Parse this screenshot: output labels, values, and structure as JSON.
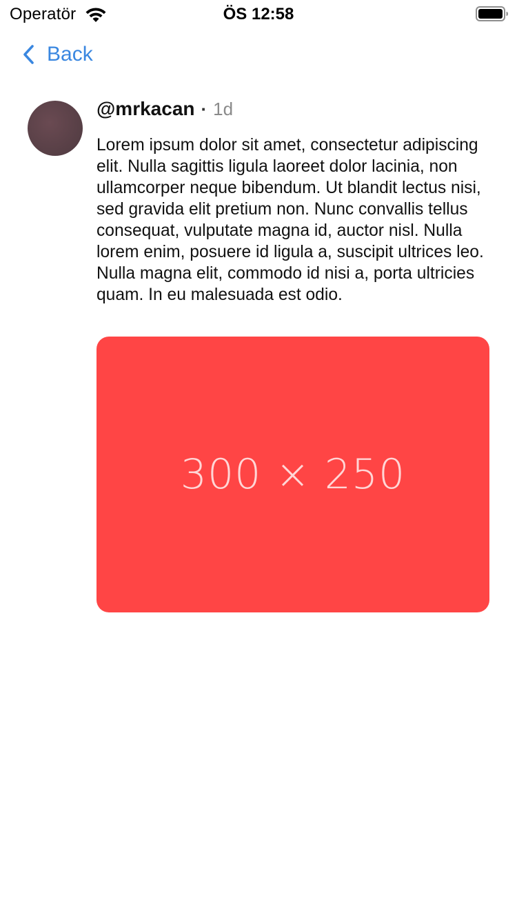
{
  "status_bar": {
    "carrier": "Operatör",
    "time": "ÖS 12:58",
    "icons": [
      "wifi-icon",
      "battery-icon"
    ]
  },
  "nav": {
    "back_label": "Back",
    "back_icon": "chevron-left-icon",
    "accent_color": "#3a87e0"
  },
  "post": {
    "username": "@mrkacan",
    "separator": "·",
    "time_ago": "1d",
    "body": "Lorem ipsum dolor sit amet, consectetur adipiscing elit. Nulla sagittis ligula laoreet dolor lacinia, non ullamcorper neque bibendum. Ut blandit lectus nisi, sed gravida elit pretium non. Nunc convallis tellus consequat, vulputate magna id, auctor nisl. Nulla lorem enim, posuere id ligula a, suscipit ultrices leo. Nulla magna elit, commodo id nisi a, porta ultricies quam. In eu malesuada est odio.",
    "media": {
      "label": "300 × 250",
      "background_color": "#ff4545"
    },
    "avatar_color": "#5a4249"
  }
}
